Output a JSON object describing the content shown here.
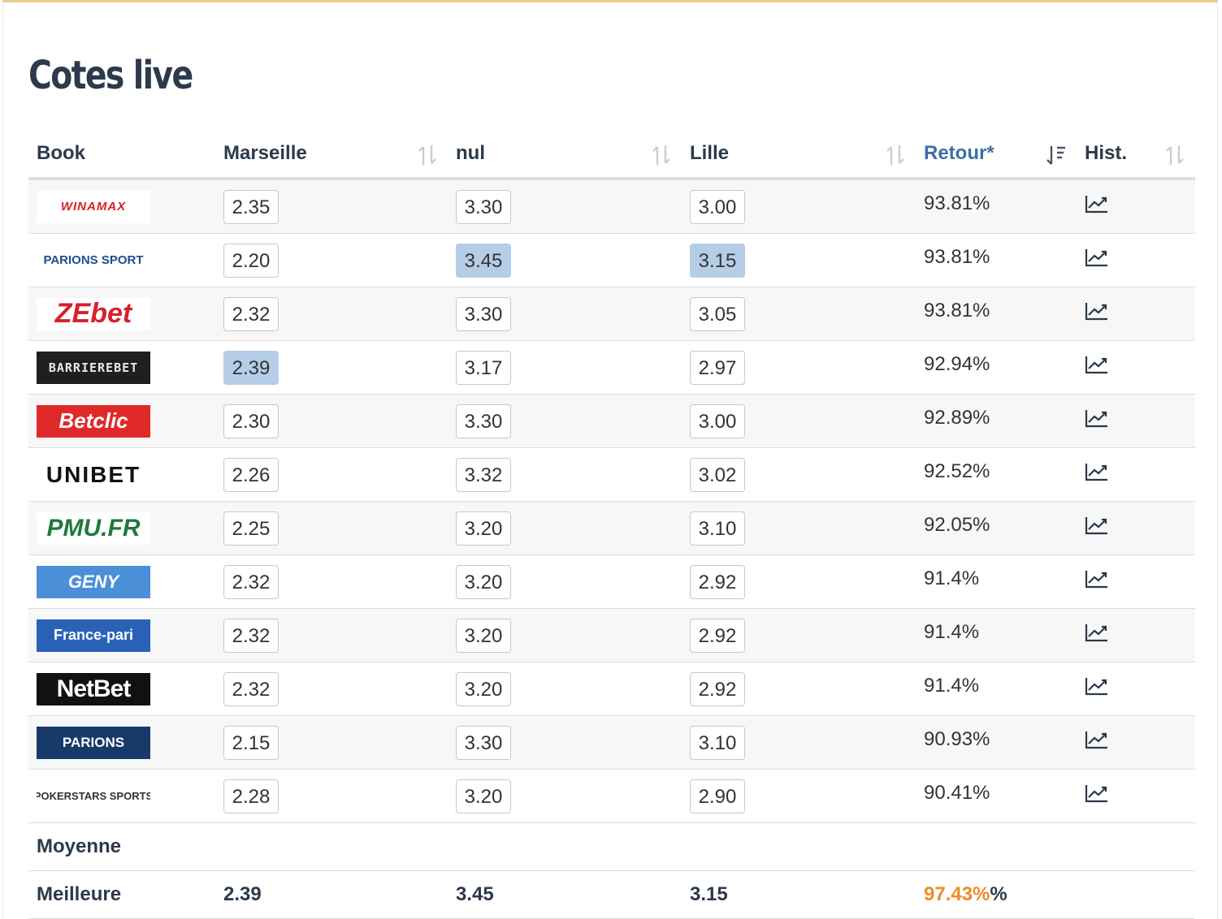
{
  "title": "Cotes live",
  "columns": {
    "book": "Book",
    "home": "Marseille",
    "draw": "nul",
    "away": "Lille",
    "ret": "Retour*",
    "hist": "Hist."
  },
  "rows": [
    {
      "book": "WINAMAX",
      "home": "2.35",
      "draw": "3.30",
      "away": "3.00",
      "ret": "93.81%"
    },
    {
      "book": "PARIONS SPORT",
      "home": "2.20",
      "draw": "3.45",
      "away": "3.15",
      "ret": "93.81%"
    },
    {
      "book": "ZEbet",
      "home": "2.32",
      "draw": "3.30",
      "away": "3.05",
      "ret": "93.81%"
    },
    {
      "book": "BARRIEREBET",
      "home": "2.39",
      "draw": "3.17",
      "away": "2.97",
      "ret": "92.94%"
    },
    {
      "book": "Betclic",
      "home": "2.30",
      "draw": "3.30",
      "away": "3.00",
      "ret": "92.89%"
    },
    {
      "book": "UNIBET",
      "home": "2.26",
      "draw": "3.32",
      "away": "3.02",
      "ret": "92.52%"
    },
    {
      "book": "PMU.FR",
      "home": "2.25",
      "draw": "3.20",
      "away": "3.10",
      "ret": "92.05%"
    },
    {
      "book": "GENY",
      "home": "2.32",
      "draw": "3.20",
      "away": "2.92",
      "ret": "91.4%"
    },
    {
      "book": "France-pari",
      "home": "2.32",
      "draw": "3.20",
      "away": "2.92",
      "ret": "91.4%"
    },
    {
      "book": "NetBet",
      "home": "2.32",
      "draw": "3.20",
      "away": "2.92",
      "ret": "91.4%"
    },
    {
      "book": "PARIONS",
      "home": "2.15",
      "draw": "3.30",
      "away": "3.10",
      "ret": "90.93%"
    },
    {
      "book": "POKERSTARS SPORTS",
      "home": "2.28",
      "draw": "3.20",
      "away": "2.90",
      "ret": "90.41%"
    }
  ],
  "footer": {
    "average_label": "Moyenne",
    "best_label": "Meilleure",
    "best_home": "2.39",
    "best_draw": "3.45",
    "best_away": "3.15",
    "best_ret": "97.43%",
    "best_ret_suffix": "%"
  },
  "colors": {
    "accent_blue": "#3b6fa8",
    "best_highlight": "#b5cde6",
    "best_return": "#f08a24",
    "top_border": "#f0c890"
  }
}
